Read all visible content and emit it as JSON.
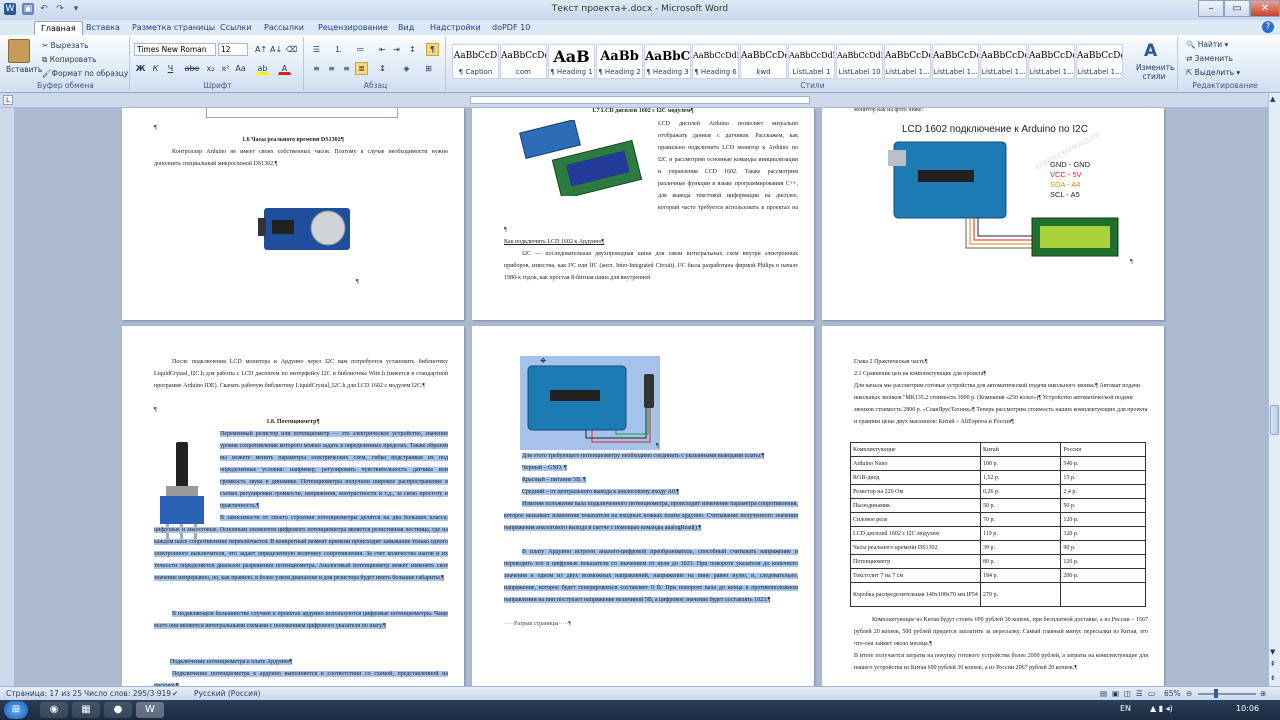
{
  "window": {
    "title": "Текст проекта+.docx - Microsoft Word"
  },
  "tabs": [
    "Главная",
    "Вставка",
    "Разметка страницы",
    "Ссылки",
    "Рассылки",
    "Рецензирование",
    "Вид",
    "Надстройки",
    "doPDF 10"
  ],
  "ribbon": {
    "clipboard": {
      "paste": "Вставить",
      "cut": "Вырезать",
      "copy": "Копировать",
      "format_painter": "Формат по образцу",
      "label": "Буфер обмена"
    },
    "font": {
      "family": "Times New Roman",
      "size": "12",
      "label": "Шрифт"
    },
    "paragraph": {
      "label": "Абзац"
    },
    "styles": {
      "label": "Стили",
      "items": [
        {
          "preview": "AaBbCcD",
          "name": "¶ Caption"
        },
        {
          "preview": "AaBbCcDc",
          "name": "com"
        },
        {
          "preview": "AaB",
          "name": "¶ Heading 1"
        },
        {
          "preview": "AaBb",
          "name": "¶ Heading 2"
        },
        {
          "preview": "AaBbC",
          "name": "¶ Heading 3"
        },
        {
          "preview": "AaBbCcDdE",
          "name": "¶ Heading 6"
        },
        {
          "preview": "AaBbCcDc",
          "name": "kwd"
        },
        {
          "preview": "AaBbCcDdE",
          "name": "ListLabel 1"
        },
        {
          "preview": "AaBbCcDdE",
          "name": "ListLabel 10"
        },
        {
          "preview": "AaBbCcDc",
          "name": "ListLabel 1..."
        },
        {
          "preview": "AaBbCcDc",
          "name": "ListLabel 1..."
        },
        {
          "preview": "AaBbCcDc",
          "name": "ListLabel 1..."
        },
        {
          "preview": "AaBbCcDc",
          "name": "ListLabel 1..."
        },
        {
          "preview": "AaBbCcDc",
          "name": "ListLabel 1..."
        }
      ],
      "change": "Изменить стили"
    },
    "editing": {
      "find": "Найти",
      "replace": "Заменить",
      "select": "Выделить",
      "label": "Редактирование"
    }
  },
  "pages": {
    "p1": {
      "heading": "1.6 Часы реального времени DS1302¶",
      "body": "Контроллер Arduino не имеет своих собственных часов. Поэтому в случае необходимости нужно дополнить специальный микросхемой DS1302.¶",
      "para1": "¶",
      "para2": "¶"
    },
    "p2": {
      "heading": "1.7 LCD дисплей 1602 с I2C модулем¶",
      "body1": "LCD дисплей Arduino позволяет визуально отображать данные с датчиков. Расскажем, как правильно подключить LCD монитор к Arduino по I2C и рассмотрим основные команды инициализации и управления LCD 1602. Также рассмотрим различные функции в языке программирования С++, для вывода текстовой информации на дисплее, который часто требуется использовать в проектах на Ардуино.¶",
      "sub": "Как подключить LCD 1602 к Ардуино¶",
      "body2": "I2C — последовательная двухпроводная шина для связи интегральных схем внутри электронных приборов, известна, как I²C или IIC (англ. Inter-Integrated Circuit). I²C была разработана фирмой Philips в начале 1980-х годов, как простая 8-битная шина для внутренней"
    },
    "p3": {
      "top": "монитор как на фото ниже:",
      "diagram_title": "LCD 1602 подключение к Arduino по I2C",
      "pins": [
        {
          "text": "GND - GND",
          "color": "#222222"
        },
        {
          "text": "VCC - 5V",
          "color": "#e02020"
        },
        {
          "text": "SDA - A4",
          "color": "#e08a00"
        },
        {
          "text": "SCL - A5",
          "color": "#222222"
        }
      ],
      "watermark": "РОБОТЕХНИКА18.РФ"
    },
    "p4": {
      "body1": "После подключения LCD монитора к Ардуино через I2C вам потребуется установить библиотеку LiquidCrystal_I2C.h для работы с LCD дисплеем по интерфейсу I2C и библиотека Wire.h (имеется в стандартной программе Arduino IDE). Скачать рабочую библиотеку LiquidCrystal_I2C.h для LCD 1602 с модулем I2C.¶",
      "heading": "1.8. Потенциометр¶",
      "body2": "Переменный резистор или потенциометр — это электрическое устройство, значение уровня сопротивления которого можно задать в определенных пределах. Также образом вы можете менять параметры электрических схем, гибко подстраивая их под определенные условия: например, регулировать чувствительность датчика или громкость звука в динамике. Потенциометры получили широкое распространение в схемах регулировки громкости, напряжения, контрастности и т.д., за свою простоту и практичность.¶",
      "body3": "В зависимости от своего строения потенциометры делятся на два больших класса: цифровые и аналоговые. Основным элементом цифрового потенциометра является резистивная лестница, где на каждом шаге сопротивление переключается. В конкретный момент времени происходит замыкание только одного электронного выключателя, что задает определенную величину сопротивления. За счет количества шагов и их точности определяется диапазон разрешения потенциометра. Аналоговый потенциометр может изменять свое значение непрерывно, но, как правило, в более узком диапазоне и для резистора будет иметь большие габариты.¶",
      "body4": "В подавляющем большинстве случаев в проектах ардуино используются цифровые потенциометры. Чаще всего они являются интегральными схемами с положением цифрового указателя по шагу.¶",
      "sub": "Подключение потенциометра к плате Ардуино¶",
      "body5": "Подключение потенциометра к ардуино выполняется в соответствии со схемой, представленной на рисунке.¶"
    },
    "p5": {
      "body1": "Для этого требующего потенциометру необходимо соединить с указанными выводами платы:¶",
      "items": [
        "Черный – GND. ¶",
        "Красный – питание 5В. ¶",
        "Средний – от центрального вывода к аналоговому входу A0.¶"
      ],
      "body2": "Изменяя положение вала подключенного потенциометра, происходит изменение параметра сопротивления, которое вызывает изменение показателя на входных ножках платы ардуино. Считывание полученного значения напряжения аналогового выхода в скетче с помощью команды analogRead().¶",
      "body3": "В плату Ардуино встроен аналого-цифровой преобразователь, способный считывать напряжение и переводить его в цифровые показатели со значением от нуля до 1023. При повороте указателя до конечного значения в одном из двух возможных направлений, напряжение на пине равно нулю, и, следовательно, напряжение, которое будет генерироваться составляет 0 В. При повороте вала до конца в противоположном направлении на пин поступает напряжение величиной 5В, а цифровое значение будет составлять 1023.¶",
      "pagebreak": "Разрыв страницы"
    },
    "p6": {
      "heading": "Глава 2 Практическая часть¶",
      "sub": "2.1 Сравнение цен на комплектующие для проекта¶",
      "body1": "Для начала мы рассмотрим готовые устройства для автоматической подачи школьного звонка.¶ Автомат подачи школьных звонков \"МК135.2 стоимость 3900 р. (Компания «250 вольт»)¶ Устройство автоматической подачи звонков стоимость 2800 р. «СлавЯрусТехник»¶ Теперь рассмотрим стоимость наших комплектующих для проекта и сравним цены двух магазинов: Китай – AliExpress и Россия¶",
      "table": {
        "headers": [
          "Комплектующие",
          "Китай",
          "Россия"
        ],
        "rows": [
          [
            "Arduino Nano",
            "100 р.",
            "540 р."
          ],
          [
            "RGB-диод",
            "1,52 р.",
            "15 р."
          ],
          [
            "Резистор на 220 Ом",
            "0,26 р.",
            "2,4 р."
          ],
          [
            "Пьезодинамик",
            "50 р.",
            "50 р."
          ],
          [
            "Силовое реле",
            "70 р.",
            "120 р."
          ],
          [
            "LCD дисплей 1602 с I2C модулем",
            "119 р.",
            "320 р."
          ],
          [
            "Часы реального времени DS1302",
            "39 р.",
            "90 р."
          ],
          [
            "Потенциометр",
            "80 р.",
            "120 р."
          ],
          [
            "Текстолит 7 на 7 см",
            "184 р.",
            "200 р."
          ],
          [
            "Коробка распределительная 140х100х70 мм IP54",
            "270 р.",
            ""
          ]
        ]
      },
      "body2": "Комплектующие из Китая будут стоить 699 рублей 30 копеек, при бесплатной доставке, а из России – 1567 рублей 20 копеек, 500 рублей придется заплатить за пересылку. Самый главный минус пересылки из Китая, это что-она займет около месяца.¶",
      "body3": "В итоге получается затраты на покупку готового устройства более 2000 рублей, а затраты на комплектующие для нашего устройства из Китая 699 рублей 30 копеек, а из России 2067 рублей 20 копеек.¶"
    }
  },
  "status": {
    "page": "Страница: 17 из 25",
    "words": "Число слов: 295/3 919",
    "lang": "Русский (Россия)",
    "zoom": "65%"
  },
  "taskbar": {
    "lang": "EN",
    "time": "10:06"
  }
}
